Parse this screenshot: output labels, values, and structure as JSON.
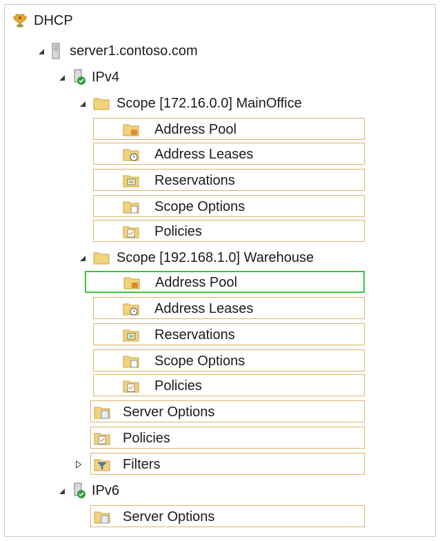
{
  "tree": {
    "root": {
      "label": "DHCP",
      "icon": "dhcp-trophy-icon"
    },
    "server": {
      "label": "server1.contoso.com",
      "icon": "server-icon"
    },
    "ipv4": {
      "label": "IPv4",
      "icon": "ipv4-node-icon"
    },
    "scope1": {
      "label": "Scope [172.16.0.0] MainOffice",
      "icon": "folder-icon",
      "children": [
        {
          "label": "Address Pool",
          "icon": "address-pool-icon"
        },
        {
          "label": "Address Leases",
          "icon": "address-leases-icon"
        },
        {
          "label": "Reservations",
          "icon": "reservations-icon"
        },
        {
          "label": "Scope Options",
          "icon": "scope-options-icon"
        },
        {
          "label": "Policies",
          "icon": "policies-icon"
        }
      ]
    },
    "scope2": {
      "label": "Scope [192.168.1.0] Warehouse",
      "icon": "folder-icon",
      "children": [
        {
          "label": "Address Pool",
          "icon": "address-pool-icon",
          "selected": true
        },
        {
          "label": "Address Leases",
          "icon": "address-leases-icon"
        },
        {
          "label": "Reservations",
          "icon": "reservations-icon"
        },
        {
          "label": "Scope Options",
          "icon": "scope-options-icon"
        },
        {
          "label": "Policies",
          "icon": "policies-icon"
        }
      ]
    },
    "ipv4_items": [
      {
        "label": "Server Options",
        "icon": "server-options-icon"
      },
      {
        "label": "Policies",
        "icon": "policies-icon"
      },
      {
        "label": "Filters",
        "icon": "filters-icon"
      }
    ],
    "ipv6": {
      "label": "IPv6",
      "icon": "ipv6-node-icon",
      "children": [
        {
          "label": "Server Options",
          "icon": "server-options-icon"
        }
      ]
    }
  },
  "colors": {
    "box_border": "#d8b46a",
    "selection": "#3cc43c",
    "folder": "#f2d27a"
  }
}
